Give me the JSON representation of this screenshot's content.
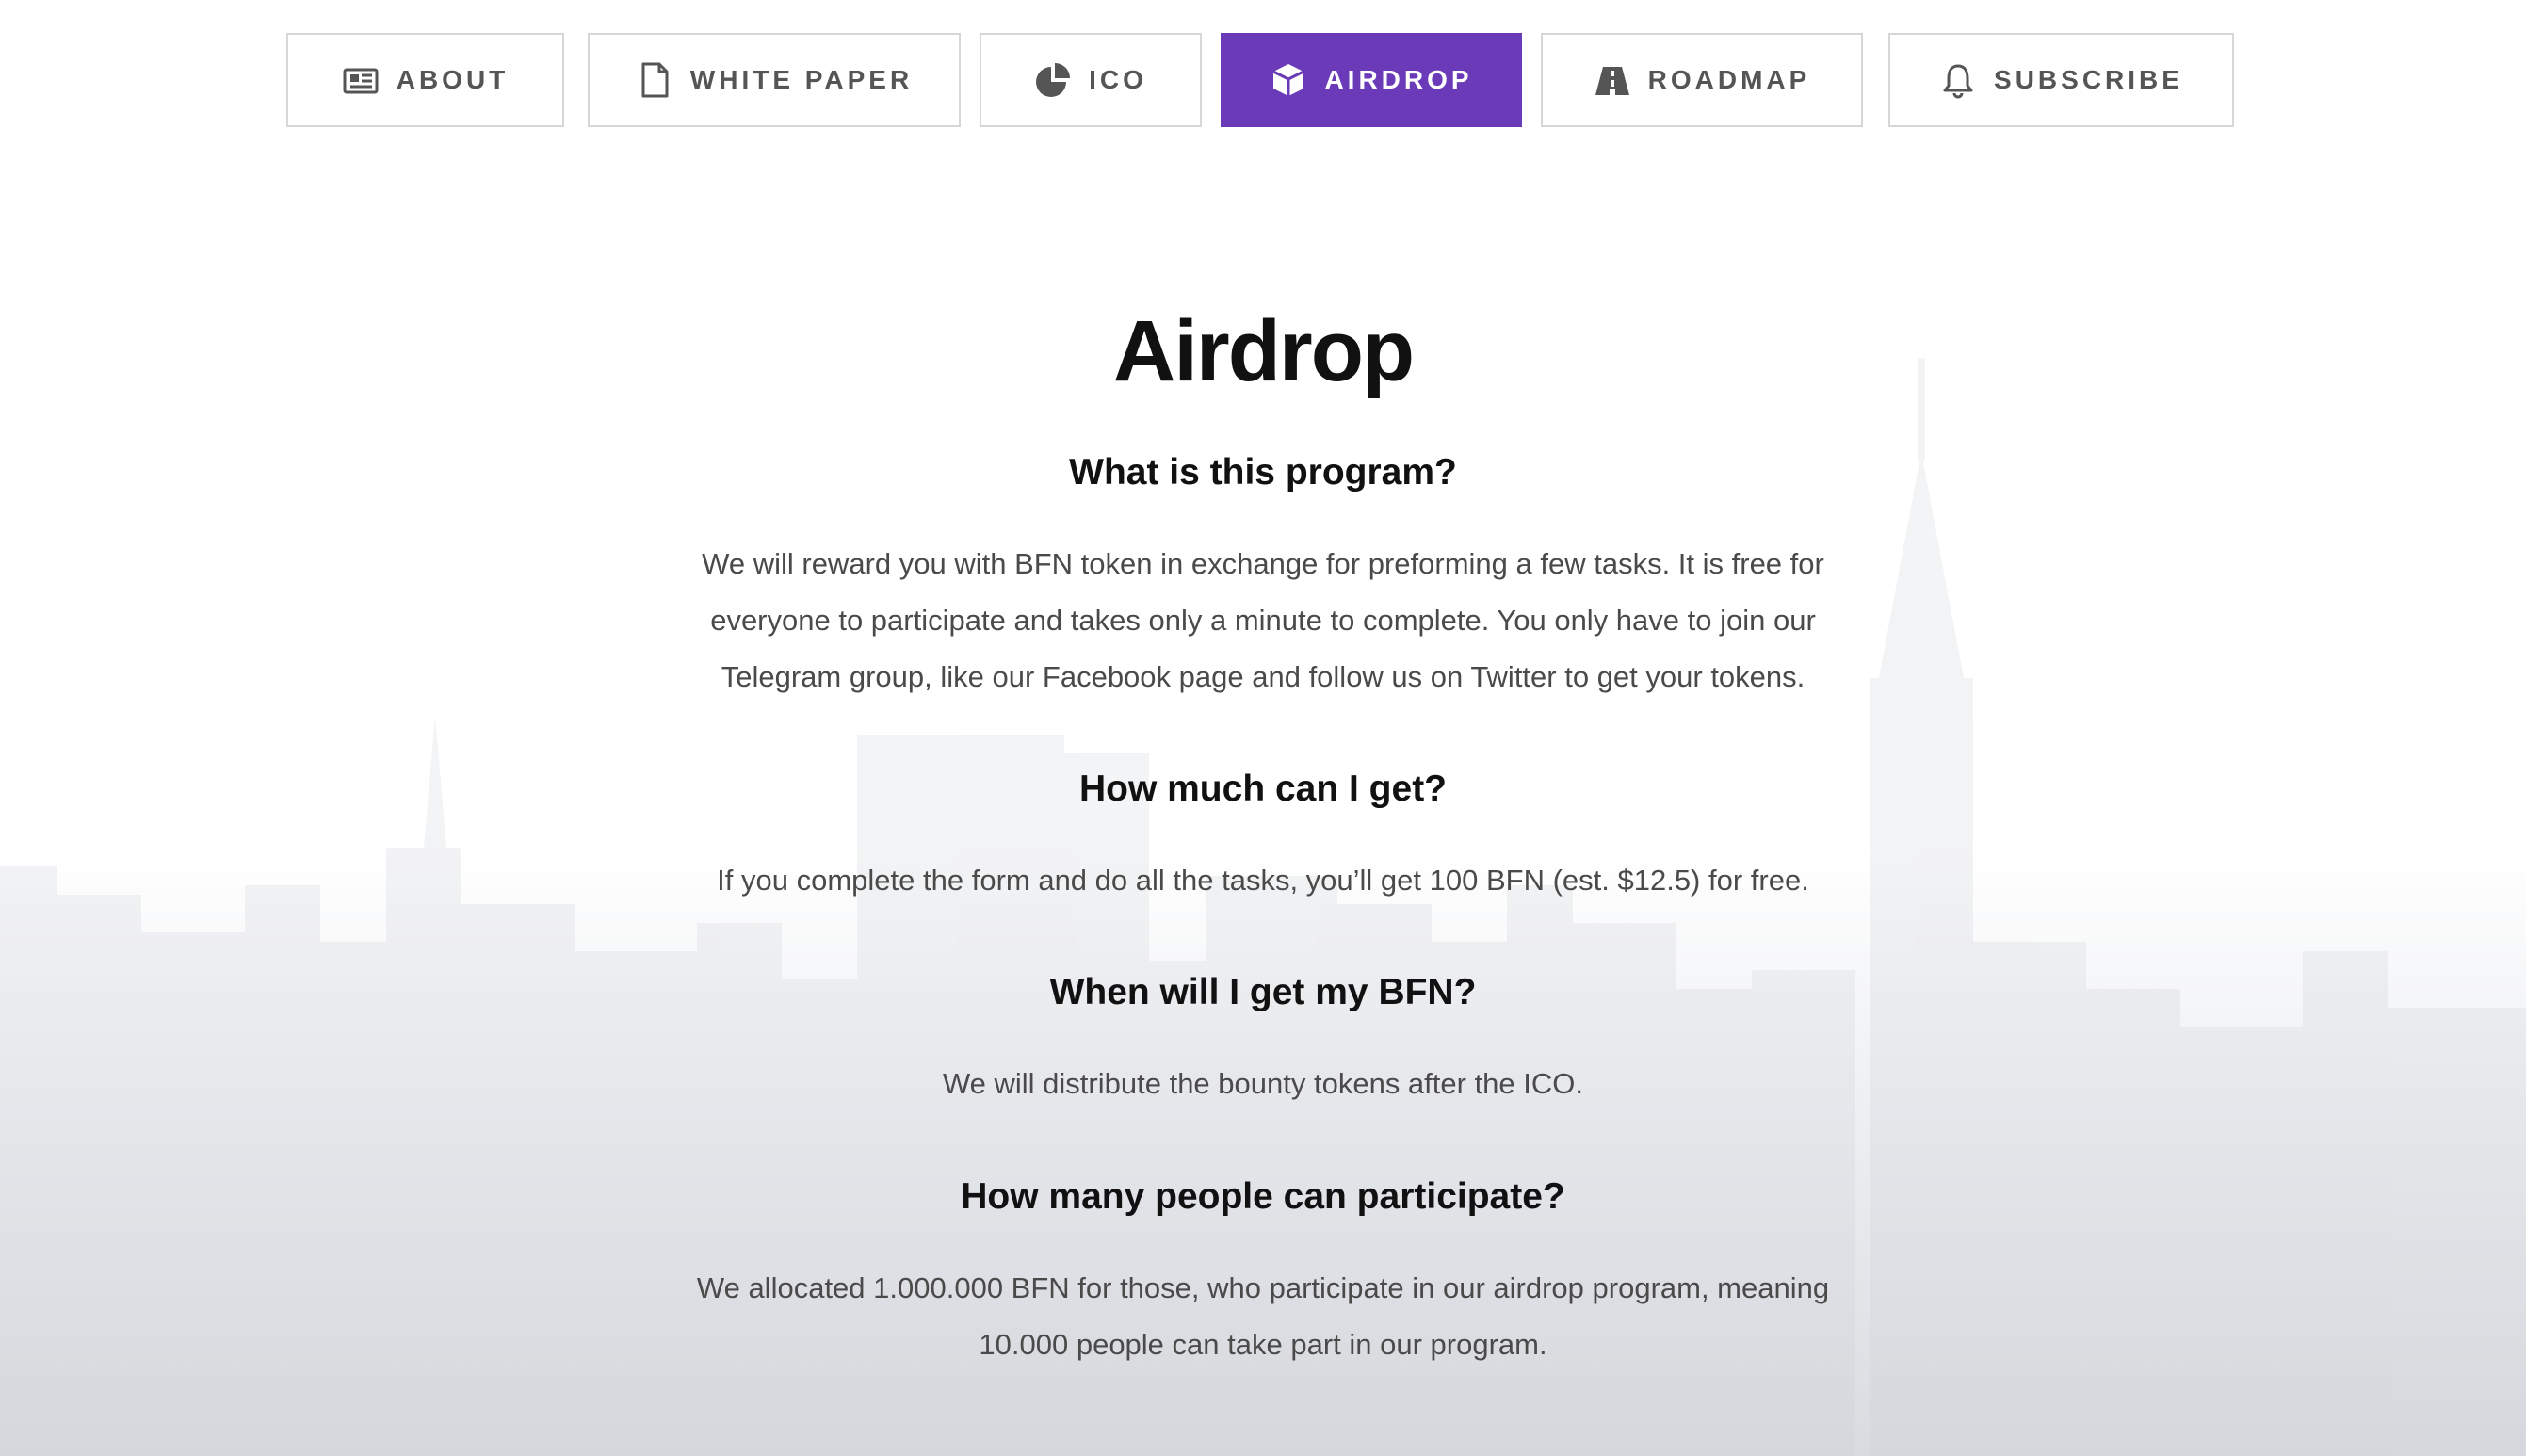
{
  "nav": {
    "tabs": [
      {
        "label": "ABOUT",
        "icon": "newspaper-icon",
        "active": false
      },
      {
        "label": "WHITE PAPER",
        "icon": "document-icon",
        "active": false
      },
      {
        "label": "ICO",
        "icon": "pie-chart-icon",
        "active": false
      },
      {
        "label": "AIRDROP",
        "icon": "cube-icon",
        "active": true
      },
      {
        "label": "ROADMAP",
        "icon": "road-icon",
        "active": false
      },
      {
        "label": "SUBSCRIBE",
        "icon": "bell-icon",
        "active": false
      }
    ],
    "active_color": "#6a3ab9"
  },
  "section": {
    "title": "Airdrop",
    "faq": [
      {
        "question": "What is this program?",
        "answer": "We will reward you with BFN token in exchange for preforming a few tasks. It is free for everyone to participate and takes only a minute to complete. You only have to join our Telegram group, like our Facebook page and follow us on Twitter to get your tokens."
      },
      {
        "question": "How much can I get?",
        "answer": "If you complete the form and do all the tasks, you’ll get 100 BFN (est. $12.5) for free."
      },
      {
        "question": "When will I get my BFN?",
        "answer": "We will distribute the bounty tokens after the ICO."
      },
      {
        "question": "How many people can participate?",
        "answer": "We allocated 1.000.000 BFN for those, who participate in our airdrop program, meaning 10.000 people can take part in our program."
      }
    ]
  }
}
